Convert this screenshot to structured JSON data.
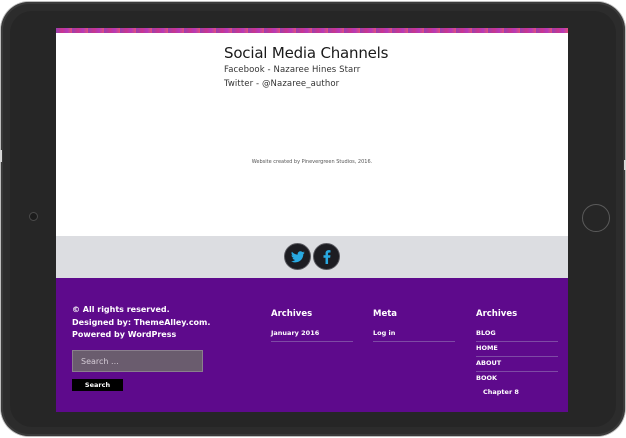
{
  "social": {
    "title": "Social Media Channels",
    "facebook_line": "Facebook - Nazaree Hines Starr",
    "twitter_line": "Twitter - @Nazaree_author"
  },
  "credit": "Website created by Pinevergreen Studios, 2016.",
  "social_icons": [
    {
      "name": "twitter-icon",
      "glyph": "twitter"
    },
    {
      "name": "facebook-icon",
      "glyph": "facebook"
    }
  ],
  "footer": {
    "rights": "© All rights reserved.",
    "designed_by": "Designed by: ThemeAlley.com.",
    "powered_by": "Powered by WordPress",
    "search_placeholder": "Search ...",
    "search_button": "Search",
    "archives_title": "Archives",
    "archives_items": [
      "January 2016"
    ],
    "meta_title": "Meta",
    "meta_items": [
      "Log in"
    ],
    "nav_title": "Archives",
    "nav_items": [
      "BLOG",
      "HOME",
      "ABOUT",
      "BOOK"
    ],
    "nav_sub_items": [
      "Chapter 8"
    ]
  },
  "colors": {
    "footer_bg": "#5e0a8c",
    "social_bar_bg": "#dcdde1",
    "icon_blue": "#29a9e1"
  }
}
